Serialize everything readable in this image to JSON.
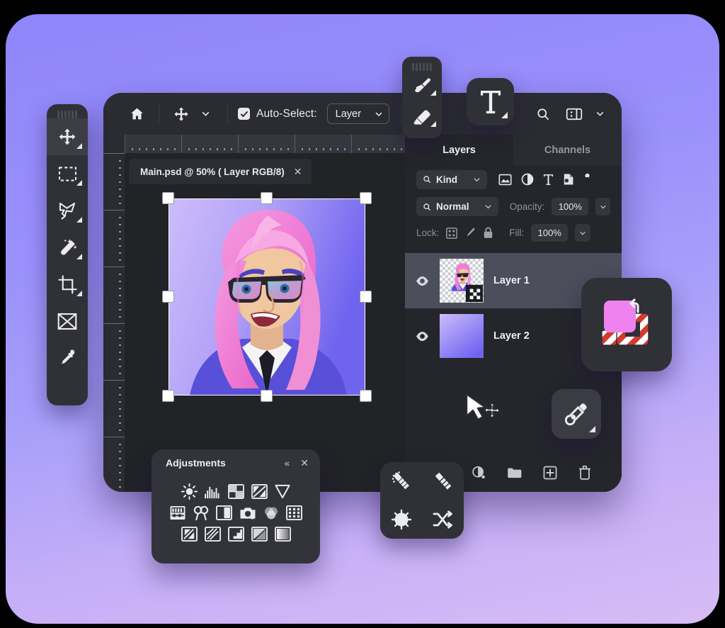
{
  "backdrop": {
    "gradient_from": "#9A91FB",
    "gradient_to": "#D3B8F5"
  },
  "app": {
    "accent_pink": "#EE82EE",
    "panel_bg": "#25262B",
    "toolbar_bg": "#2B2C31"
  },
  "toolbar": {
    "home_icon": "home-icon",
    "move_tool_icon": "move-tool-icon",
    "move_dropdown_icon": "chevron-down-icon",
    "autoselect_checked": true,
    "autoselect_label": "Auto-Select:",
    "layer_select_value": "Layer",
    "layer_select_caret": "chevron-down-icon",
    "search_icon": "search-icon",
    "workspace_icon": "workspace-icon",
    "workspace_caret": "chevron-down-icon"
  },
  "document": {
    "tab_title": "Main.psd @ 50% ( Layer RGB/8)",
    "close_label": "✕",
    "zoom": "50%",
    "color_mode": "Layer RGB/8"
  },
  "left_toolbar": {
    "tools": [
      {
        "name": "move-tool",
        "icon": "move-tool-icon",
        "active": true,
        "has_flyout": true
      },
      {
        "name": "rectangular-marquee-tool",
        "icon": "marquee-icon",
        "active": false,
        "has_flyout": true
      },
      {
        "name": "lasso-tool",
        "icon": "lasso-icon",
        "active": false,
        "has_flyout": true
      },
      {
        "name": "magic-wand-tool",
        "icon": "magic-wand-icon",
        "active": false,
        "has_flyout": true
      },
      {
        "name": "crop-tool",
        "icon": "crop-icon",
        "active": false,
        "has_flyout": true
      },
      {
        "name": "frame-tool",
        "icon": "frame-icon",
        "active": false,
        "has_flyout": false
      },
      {
        "name": "eyedropper-tool",
        "icon": "eyedropper-icon",
        "active": false,
        "has_flyout": false
      }
    ]
  },
  "brush_strip": {
    "tools": [
      {
        "name": "brush-tool",
        "icon": "brush-icon",
        "has_flyout": true
      },
      {
        "name": "eraser-tool",
        "icon": "eraser-icon",
        "has_flyout": true
      }
    ]
  },
  "text_tool": {
    "name": "type-tool",
    "icon": "type-T-icon",
    "label": "T",
    "has_flyout": true
  },
  "pen_tool": {
    "name": "pen-tool",
    "icon": "pen-icon",
    "has_flyout": true
  },
  "color_widget": {
    "foreground_color": "#EE82EE",
    "background_color": "#FFFFFF",
    "background_is_transparent": true,
    "swap_icon": "swap-colors-icon"
  },
  "mini_grid": {
    "tools": [
      {
        "name": "blur-tool",
        "icon": "blur-icon"
      },
      {
        "name": "sharpen-tool",
        "icon": "sharpen-icon"
      },
      {
        "name": "dodge-tool",
        "icon": "dodge-icon"
      },
      {
        "name": "shuffle-tool",
        "icon": "shuffle-icon"
      }
    ]
  },
  "layers_panel": {
    "tabs": [
      {
        "label": "Layers",
        "active": true
      },
      {
        "label": "Channels",
        "active": false
      }
    ],
    "filter": {
      "kind_label": "Kind",
      "kind_search_icon": "search-icon",
      "kind_caret": "chevron-down-icon",
      "filter_icons": [
        "image-filter-icon",
        "adjustment-filter-icon",
        "text-filter-icon",
        "shape-filter-icon",
        "smart-filter-icon"
      ]
    },
    "blend": {
      "mode_label": "Normal",
      "mode_search_icon": "search-icon",
      "mode_caret": "chevron-down-icon",
      "opacity_label": "Opacity:",
      "opacity_value": "100%",
      "opacity_caret": "chevron-down-icon"
    },
    "lock": {
      "label": "Lock:",
      "icons": [
        "lock-transparent-icon",
        "lock-paint-icon",
        "lock-all-icon"
      ],
      "fill_label": "Fill:",
      "fill_value": "100%",
      "fill_caret": "chevron-down-icon"
    },
    "layers": [
      {
        "name": "Layer 1",
        "visible": true,
        "selected": true,
        "thumb": "portrait-transparent",
        "has_mask": true
      },
      {
        "name": "Layer 2",
        "visible": true,
        "selected": false,
        "thumb": "purple-gradient",
        "has_mask": false
      }
    ],
    "bottom_icons": [
      "add-mask-icon",
      "new-adjustment-layer-icon",
      "new-group-icon",
      "new-layer-icon",
      "delete-layer-icon"
    ]
  },
  "adjustments_panel": {
    "title": "Adjustments",
    "collapse_label": "«",
    "close_label": "✕",
    "rows": [
      [
        "brightness-contrast-icon",
        "levels-icon",
        "curves-icon",
        "exposure-icon",
        "vibrance-icon"
      ],
      [
        "hue-saturation-icon",
        "color-balance-icon",
        "black-white-icon",
        "photo-filter-icon",
        "channel-mixer-icon",
        "color-lookup-icon"
      ],
      [
        "invert-icon",
        "posterize-icon",
        "threshold-icon",
        "selective-color-icon",
        "gradient-map-icon"
      ]
    ]
  },
  "cursor": {
    "name": "move-cursor",
    "icon": "move-cursor-icon"
  }
}
